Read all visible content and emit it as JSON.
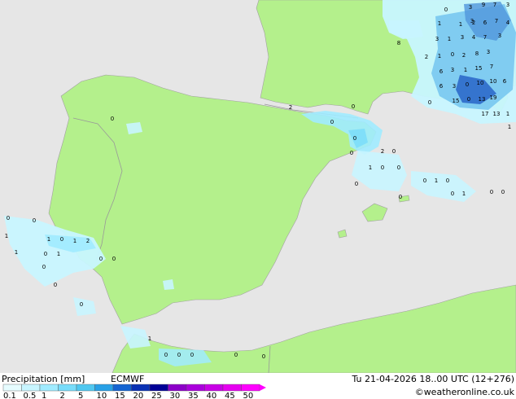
{
  "header": {
    "title": "Precipitation [mm]",
    "model": "ECMWF",
    "valid_time": "Tu 21-04-2026 18..00 UTC (12+276)",
    "credit": "©weatheronline.co.uk"
  },
  "legend": {
    "ticks": [
      "0.1",
      "0.5",
      "1",
      "2",
      "5",
      "10",
      "15",
      "20",
      "25",
      "30",
      "35",
      "40",
      "45",
      "50"
    ],
    "colors": [
      "#e6fcff",
      "#c8f5ff",
      "#a0ebff",
      "#78dcfa",
      "#50c8f0",
      "#28a0e6",
      "#1464d2",
      "#0a32b4",
      "#000096",
      "#8c00c8",
      "#aa00dc",
      "#c800e6",
      "#e600f0",
      "#ff00ff"
    ]
  },
  "colors": {
    "sea": "#e6e6e6",
    "land": "#b4f08c",
    "border": "#999999",
    "precip_light": "#c8f5ff",
    "precip_mid": "#78c8f0",
    "precip_heavy": "#2864c8"
  },
  "labels": [
    {
      "t": "0"
    },
    {
      "t": "3"
    },
    {
      "t": "9"
    },
    {
      "t": "7"
    },
    {
      "t": "3"
    },
    {
      "t": "3"
    },
    {
      "t": "1"
    },
    {
      "t": "1"
    },
    {
      "t": "2"
    },
    {
      "t": "6"
    },
    {
      "t": "7"
    },
    {
      "t": "4"
    },
    {
      "t": "3"
    },
    {
      "t": "1"
    },
    {
      "t": "3"
    },
    {
      "t": "4"
    },
    {
      "t": "7"
    },
    {
      "t": "3"
    },
    {
      "t": "8"
    },
    {
      "t": "2"
    },
    {
      "t": "1"
    },
    {
      "t": "0"
    },
    {
      "t": "2"
    },
    {
      "t": "8"
    },
    {
      "t": "3"
    },
    {
      "t": "6"
    },
    {
      "t": "3"
    },
    {
      "t": "1"
    },
    {
      "t": "15"
    },
    {
      "t": "7"
    },
    {
      "t": "6"
    },
    {
      "t": "3"
    },
    {
      "t": "0"
    },
    {
      "t": "10"
    },
    {
      "t": "10"
    },
    {
      "t": "6"
    },
    {
      "t": "0"
    },
    {
      "t": "15"
    },
    {
      "t": "0"
    },
    {
      "t": "13"
    },
    {
      "t": "19"
    },
    {
      "t": "17"
    },
    {
      "t": "13"
    },
    {
      "t": "1"
    },
    {
      "t": "1"
    },
    {
      "t": "0"
    },
    {
      "t": "2"
    },
    {
      "t": "0"
    },
    {
      "t": "0"
    },
    {
      "t": "0"
    },
    {
      "t": "0"
    },
    {
      "t": "2"
    },
    {
      "t": "0"
    },
    {
      "t": "1"
    },
    {
      "t": "0"
    },
    {
      "t": "0"
    },
    {
      "t": "0"
    },
    {
      "t": "1"
    },
    {
      "t": "0"
    },
    {
      "t": "0"
    },
    {
      "t": "0"
    },
    {
      "t": "0"
    },
    {
      "t": "1"
    },
    {
      "t": "0"
    },
    {
      "t": "0"
    },
    {
      "t": "0"
    },
    {
      "t": "0"
    },
    {
      "t": "1"
    },
    {
      "t": "1"
    },
    {
      "t": "0"
    },
    {
      "t": "1"
    },
    {
      "t": "2"
    },
    {
      "t": "1"
    },
    {
      "t": "0"
    },
    {
      "t": "1"
    },
    {
      "t": "0"
    },
    {
      "t": "0"
    },
    {
      "t": "0"
    },
    {
      "t": "0"
    },
    {
      "t": "0"
    },
    {
      "t": "1"
    },
    {
      "t": "0"
    },
    {
      "t": "0"
    },
    {
      "t": "0"
    },
    {
      "t": "0"
    },
    {
      "t": "0"
    }
  ]
}
